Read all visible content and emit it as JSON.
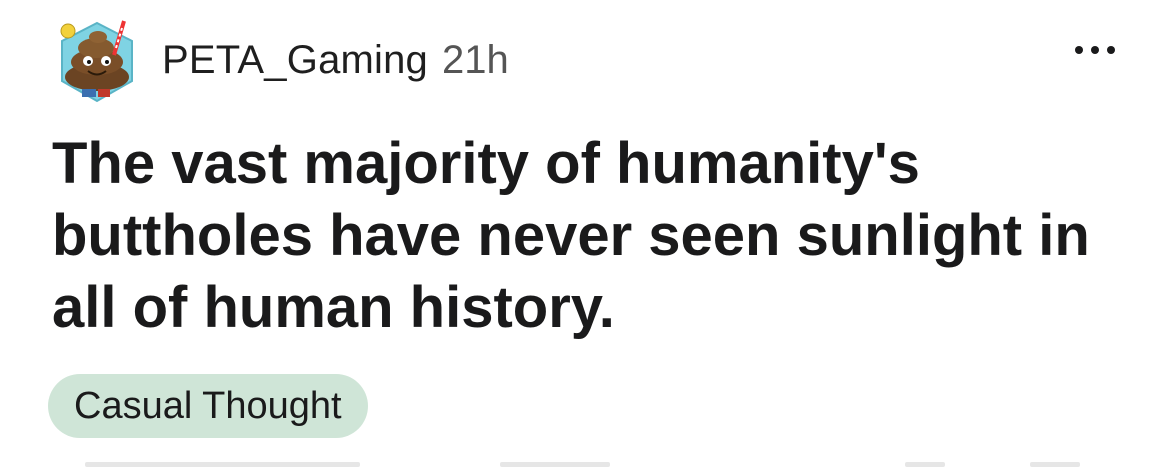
{
  "post": {
    "author": "PETA_Gaming",
    "age": "21h",
    "title": "The vast majority of humanity's buttholes have never seen sunlight in all of human history.",
    "flair": "Casual Thought"
  },
  "icons": {
    "avatar": "avatar-image",
    "more": "more-options-icon"
  },
  "colors": {
    "flair_background": "#cfe5d7",
    "avatar_background": "#7fd3e3",
    "text": "#1a1a1b"
  }
}
